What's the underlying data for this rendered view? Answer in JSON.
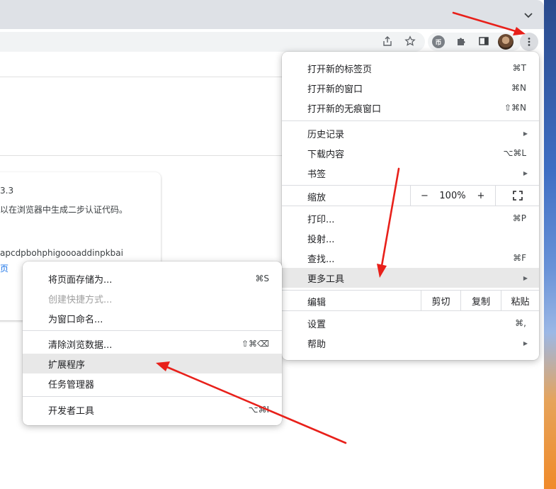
{
  "browser": {
    "ext_token": "币"
  },
  "card": {
    "version": "3.3",
    "description": "以在浏览器中生成二步认证代码。",
    "ext_id": "apcdpbohphigoooaddinpkbai",
    "link": "页"
  },
  "main_menu": {
    "new_tab": {
      "label": "打开新的标签页",
      "shortcut": "⌘T"
    },
    "new_window": {
      "label": "打开新的窗口",
      "shortcut": "⌘N"
    },
    "incognito": {
      "label": "打开新的无痕窗口",
      "shortcut": "⇧⌘N"
    },
    "history": {
      "label": "历史记录"
    },
    "downloads": {
      "label": "下载内容",
      "shortcut": "⌥⌘L"
    },
    "bookmarks": {
      "label": "书签"
    },
    "zoom": {
      "label": "缩放",
      "minus": "−",
      "level": "100%",
      "plus": "+"
    },
    "print": {
      "label": "打印...",
      "shortcut": "⌘P"
    },
    "cast": {
      "label": "投射..."
    },
    "find": {
      "label": "查找...",
      "shortcut": "⌘F"
    },
    "more_tools": {
      "label": "更多工具"
    },
    "edit": {
      "label": "编辑",
      "cut": "剪切",
      "copy": "复制",
      "paste": "粘贴"
    },
    "settings": {
      "label": "设置",
      "shortcut": "⌘,"
    },
    "help": {
      "label": "帮助"
    }
  },
  "sub_menu": {
    "save_page": {
      "label": "将页面存储为...",
      "shortcut": "⌘S"
    },
    "create_shortcut": {
      "label": "创建快捷方式..."
    },
    "name_window": {
      "label": "为窗口命名..."
    },
    "clear_data": {
      "label": "清除浏览数据...",
      "shortcut": "⇧⌘⌫"
    },
    "extensions": {
      "label": "扩展程序"
    },
    "task_manager": {
      "label": "任务管理器"
    },
    "dev_tools": {
      "label": "开发者工具",
      "shortcut": "⌥⌘I"
    }
  },
  "colors": {
    "annotation_arrow": "#e8201a",
    "highlight": "#e8e8e8",
    "link": "#1a73e8"
  }
}
